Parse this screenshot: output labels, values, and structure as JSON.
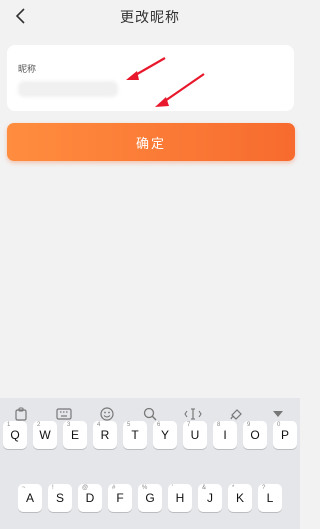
{
  "header": {
    "title": "更改昵称"
  },
  "form": {
    "label": "昵称",
    "value": "",
    "confirm_label": "确定"
  },
  "keyboard": {
    "toolbar_icons": [
      "clipboard-icon",
      "keyboard-icon",
      "emoji-icon",
      "search-icon",
      "cursor-icon",
      "theme-icon",
      "collapse-icon"
    ],
    "row1": [
      {
        "letter": "Q",
        "hint": "1"
      },
      {
        "letter": "W",
        "hint": "2"
      },
      {
        "letter": "E",
        "hint": "3"
      },
      {
        "letter": "R",
        "hint": "4"
      },
      {
        "letter": "T",
        "hint": "5"
      },
      {
        "letter": "Y",
        "hint": "6"
      },
      {
        "letter": "U",
        "hint": "7"
      },
      {
        "letter": "I",
        "hint": "8"
      },
      {
        "letter": "O",
        "hint": "9"
      },
      {
        "letter": "P",
        "hint": "0"
      }
    ],
    "row2": [
      {
        "letter": "A",
        "hint": "~"
      },
      {
        "letter": "S",
        "hint": "!"
      },
      {
        "letter": "D",
        "hint": "@"
      },
      {
        "letter": "F",
        "hint": "#"
      },
      {
        "letter": "G",
        "hint": "%"
      },
      {
        "letter": "H",
        "hint": "'"
      },
      {
        "letter": "J",
        "hint": "&"
      },
      {
        "letter": "K",
        "hint": "*"
      },
      {
        "letter": "L",
        "hint": "?"
      }
    ]
  },
  "colors": {
    "accent_start": "#ff8d3f",
    "accent_end": "#f76b2e",
    "annotation": "#e8192c"
  }
}
